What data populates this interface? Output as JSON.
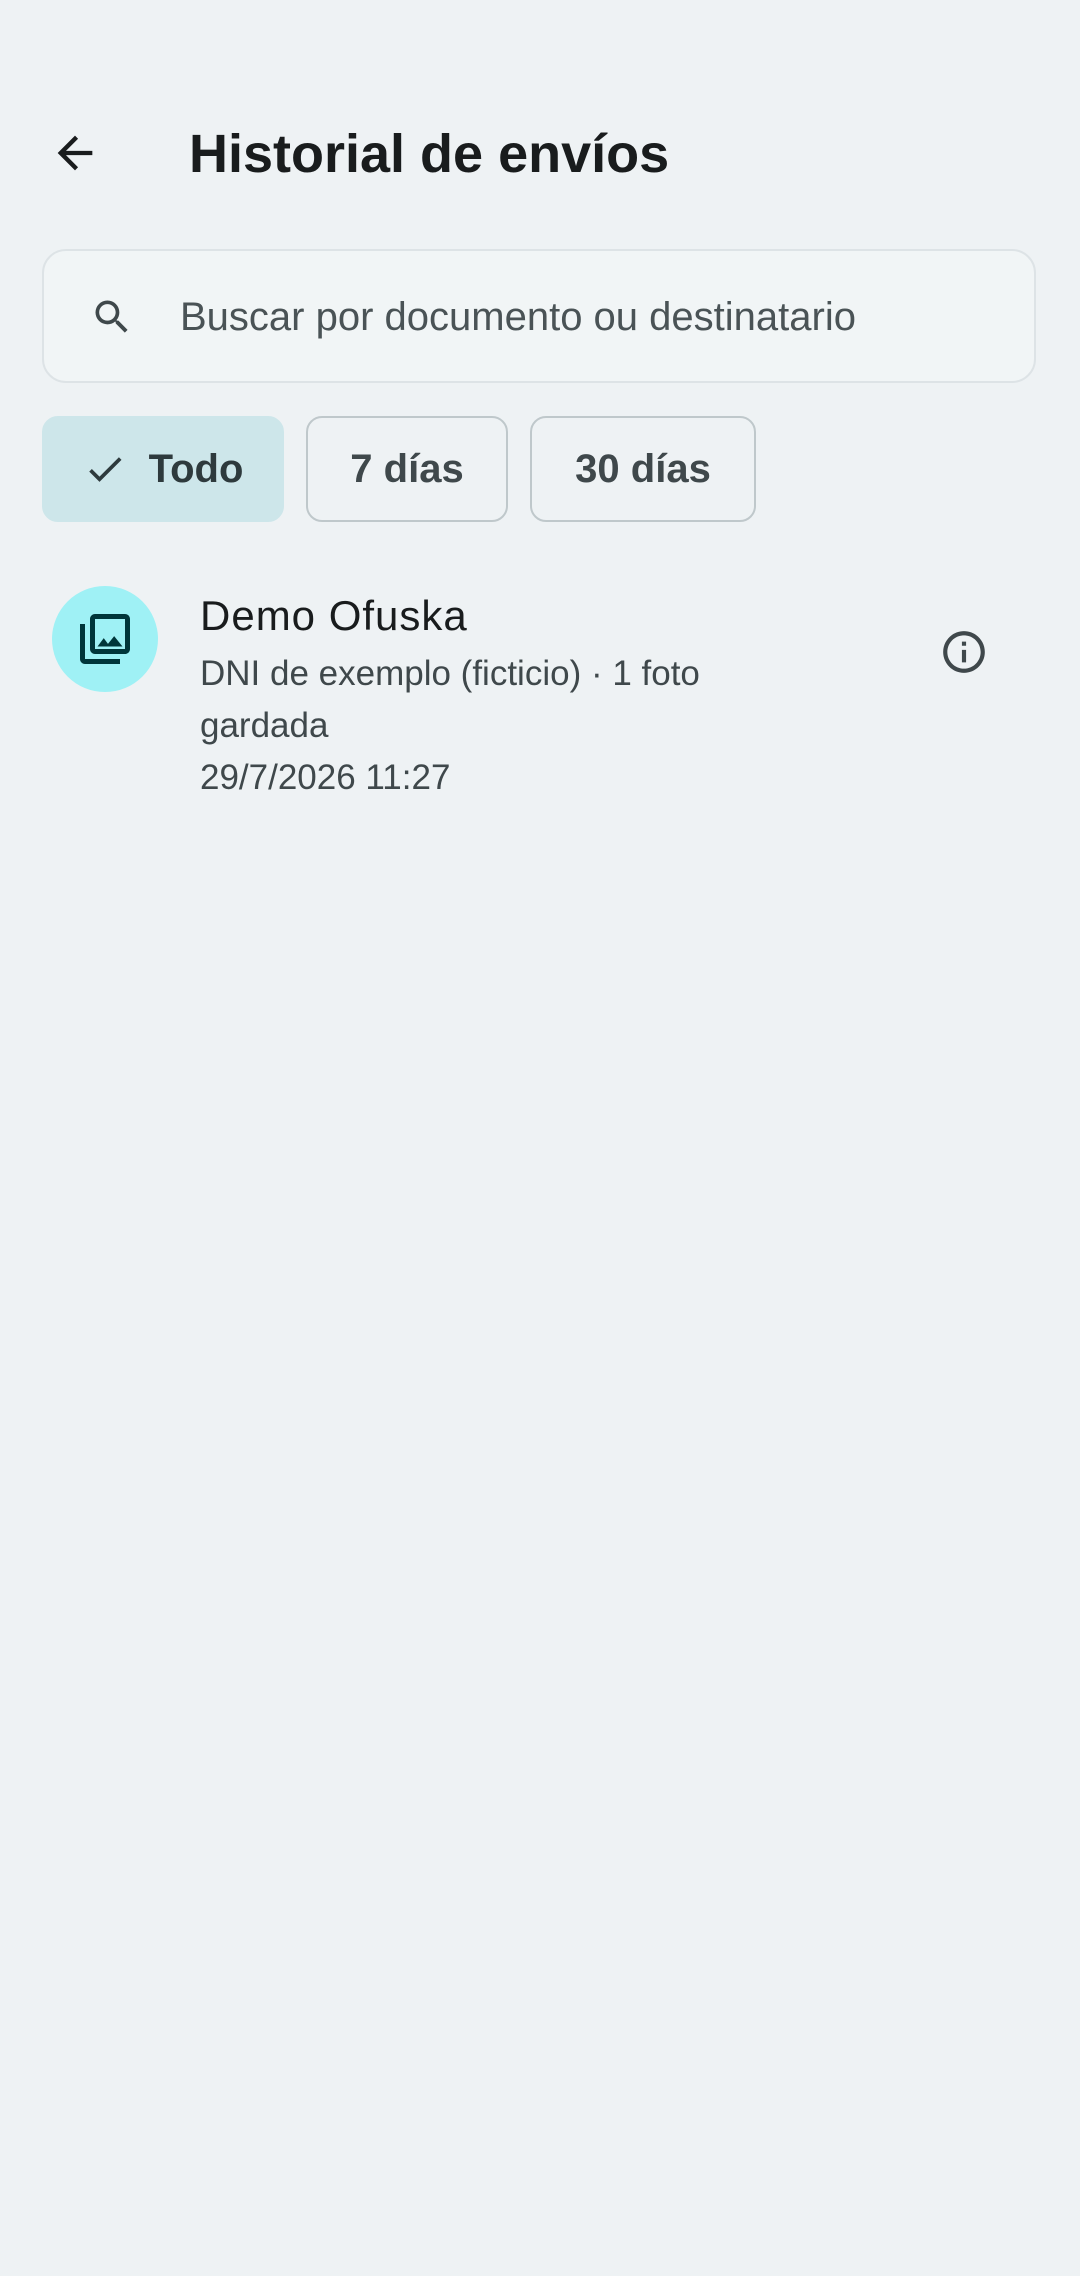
{
  "header": {
    "title": "Historial de envíos",
    "back_icon": "arrow-back-icon"
  },
  "search": {
    "placeholder": "Buscar por documento ou destinatario",
    "value": "",
    "icon": "search-icon"
  },
  "filters": [
    {
      "label": "Todo",
      "selected": true
    },
    {
      "label": "7 días",
      "selected": false
    },
    {
      "label": "30 días",
      "selected": false
    }
  ],
  "history": [
    {
      "title": "Demo Ofuska",
      "subtitle": "DNI de exemplo (ficticio) · 1 foto gardada",
      "datetime": "29/7/2026 11:27",
      "icon": "photo-library-icon",
      "action_icon": "info-icon"
    }
  ],
  "colors": {
    "background": "#EEF2F4",
    "chip_selected": "#CDE6EA",
    "avatar": "#9FF1F5",
    "icon_dark": "#00363A",
    "text_primary": "#191C1D",
    "text_secondary": "#3F484B"
  }
}
